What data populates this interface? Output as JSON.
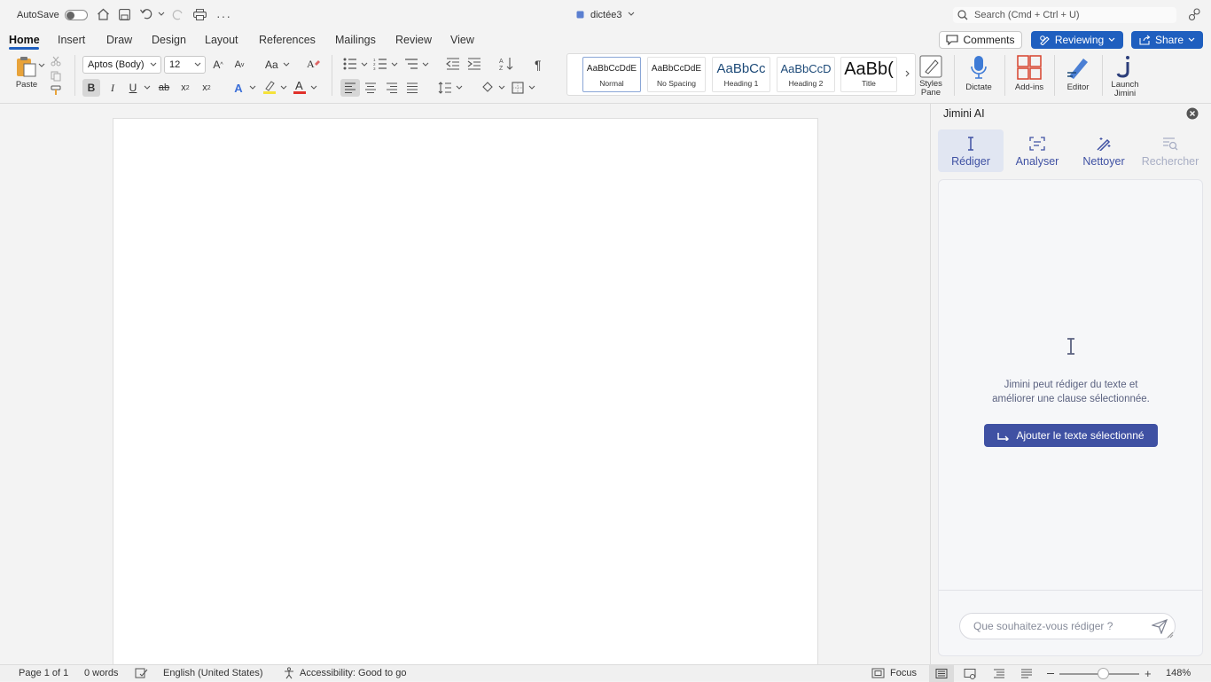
{
  "titlebar": {
    "autosave_label": "AutoSave",
    "doc_title": "dictée3",
    "search_placeholder": "Search (Cmd + Ctrl + U)"
  },
  "tabs": [
    "Home",
    "Insert",
    "Draw",
    "Design",
    "Layout",
    "References",
    "Mailings",
    "Review",
    "View"
  ],
  "actions": {
    "comments": "Comments",
    "reviewing": "Reviewing",
    "share": "Share"
  },
  "ribbon": {
    "paste": "Paste",
    "font_name": "Aptos (Body)",
    "font_size": "12",
    "font_case": "Aa",
    "styles": [
      {
        "preview": "AaBbCcDdE",
        "name": "Normal"
      },
      {
        "preview": "AaBbCcDdE",
        "name": "No Spacing"
      },
      {
        "preview": "AaBbCc",
        "name": "Heading 1"
      },
      {
        "preview": "AaBbCcD",
        "name": "Heading 2"
      },
      {
        "preview": "AaBb(",
        "name": "Title"
      }
    ],
    "styles_pane": "Styles Pane",
    "dictate": "Dictate",
    "addins": "Add-ins",
    "editor": "Editor",
    "launch_jimini": "Launch Jimini"
  },
  "panel": {
    "title": "Jimini AI",
    "tabs": [
      "Rédiger",
      "Analyser",
      "Nettoyer",
      "Rechercher"
    ],
    "message_line1": "Jimini peut rédiger du texte et",
    "message_line2": "améliorer une clause sélectionnée.",
    "add_button": "Ajouter le texte sélectionné",
    "input_placeholder": "Que souhaitez-vous rédiger ?"
  },
  "statusbar": {
    "page": "Page 1 of 1",
    "words": "0 words",
    "language": "English (United States)",
    "accessibility": "Accessibility: Good to go",
    "focus": "Focus",
    "zoom": "148%"
  },
  "colors": {
    "accent": "#1f5fbf",
    "jimini_button": "#3f51a3",
    "font_color_bar": "#e0302a",
    "highlight_bar": "#f5e23a"
  }
}
